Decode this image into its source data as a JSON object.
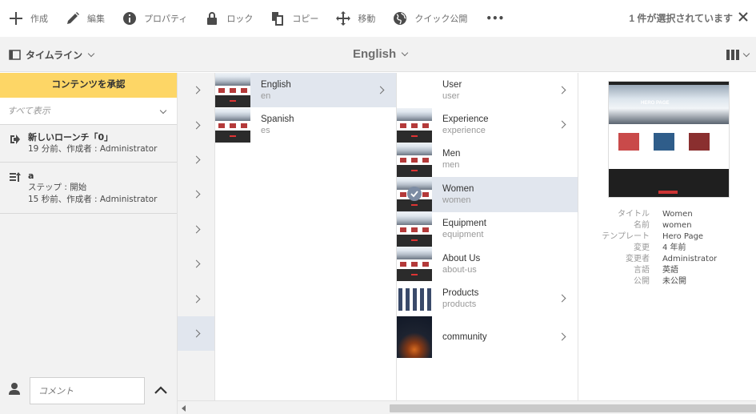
{
  "toolbar": {
    "create": "作成",
    "edit": "編集",
    "properties": "プロパティ",
    "lock": "ロック",
    "copy": "コピー",
    "move": "移動",
    "quick_publish": "クイック公開",
    "more": "•••",
    "selection_status": "1 件が選択されています"
  },
  "titlebar": {
    "rail_label": "タイムライン",
    "title": "English"
  },
  "rail": {
    "approve_button": "コンテンツを承認",
    "filter_value": "すべて表示",
    "items": [
      {
        "title": "新しいローンチ「0」",
        "meta": "19 分前、作成者 : Administrator"
      },
      {
        "title": "a",
        "step": "ステップ : 開始",
        "meta": "15 秒前、作成者 : Administrator"
      }
    ],
    "comment_placeholder": "コメント"
  },
  "column1": [
    {
      "title": "English",
      "name": "en"
    },
    {
      "title": "Spanish",
      "name": "es"
    }
  ],
  "column2": [
    {
      "title": "User",
      "name": "user"
    },
    {
      "title": "Experience",
      "name": "experience"
    },
    {
      "title": "Men",
      "name": "men"
    },
    {
      "title": "Women",
      "name": "women"
    },
    {
      "title": "Equipment",
      "name": "equipment"
    },
    {
      "title": "About Us",
      "name": "about-us"
    },
    {
      "title": "Products",
      "name": "products"
    },
    {
      "title": "community",
      "name": ""
    }
  ],
  "preview": {
    "hero_text": "HERO PAGE",
    "meta": [
      {
        "key": "タイトル",
        "value": "Women"
      },
      {
        "key": "名前",
        "value": "women"
      },
      {
        "key": "テンプレート",
        "value": "Hero Page"
      },
      {
        "key": "変更",
        "value": "4 年前"
      },
      {
        "key": "変更者",
        "value": "Administrator"
      },
      {
        "key": "言語",
        "value": "英語"
      },
      {
        "key": "公開",
        "value": "未公開"
      }
    ]
  },
  "colors": {
    "accent_yellow": "#fdd666",
    "selected_row": "#e1e6ee",
    "rail_bg": "#f2f2f2"
  }
}
